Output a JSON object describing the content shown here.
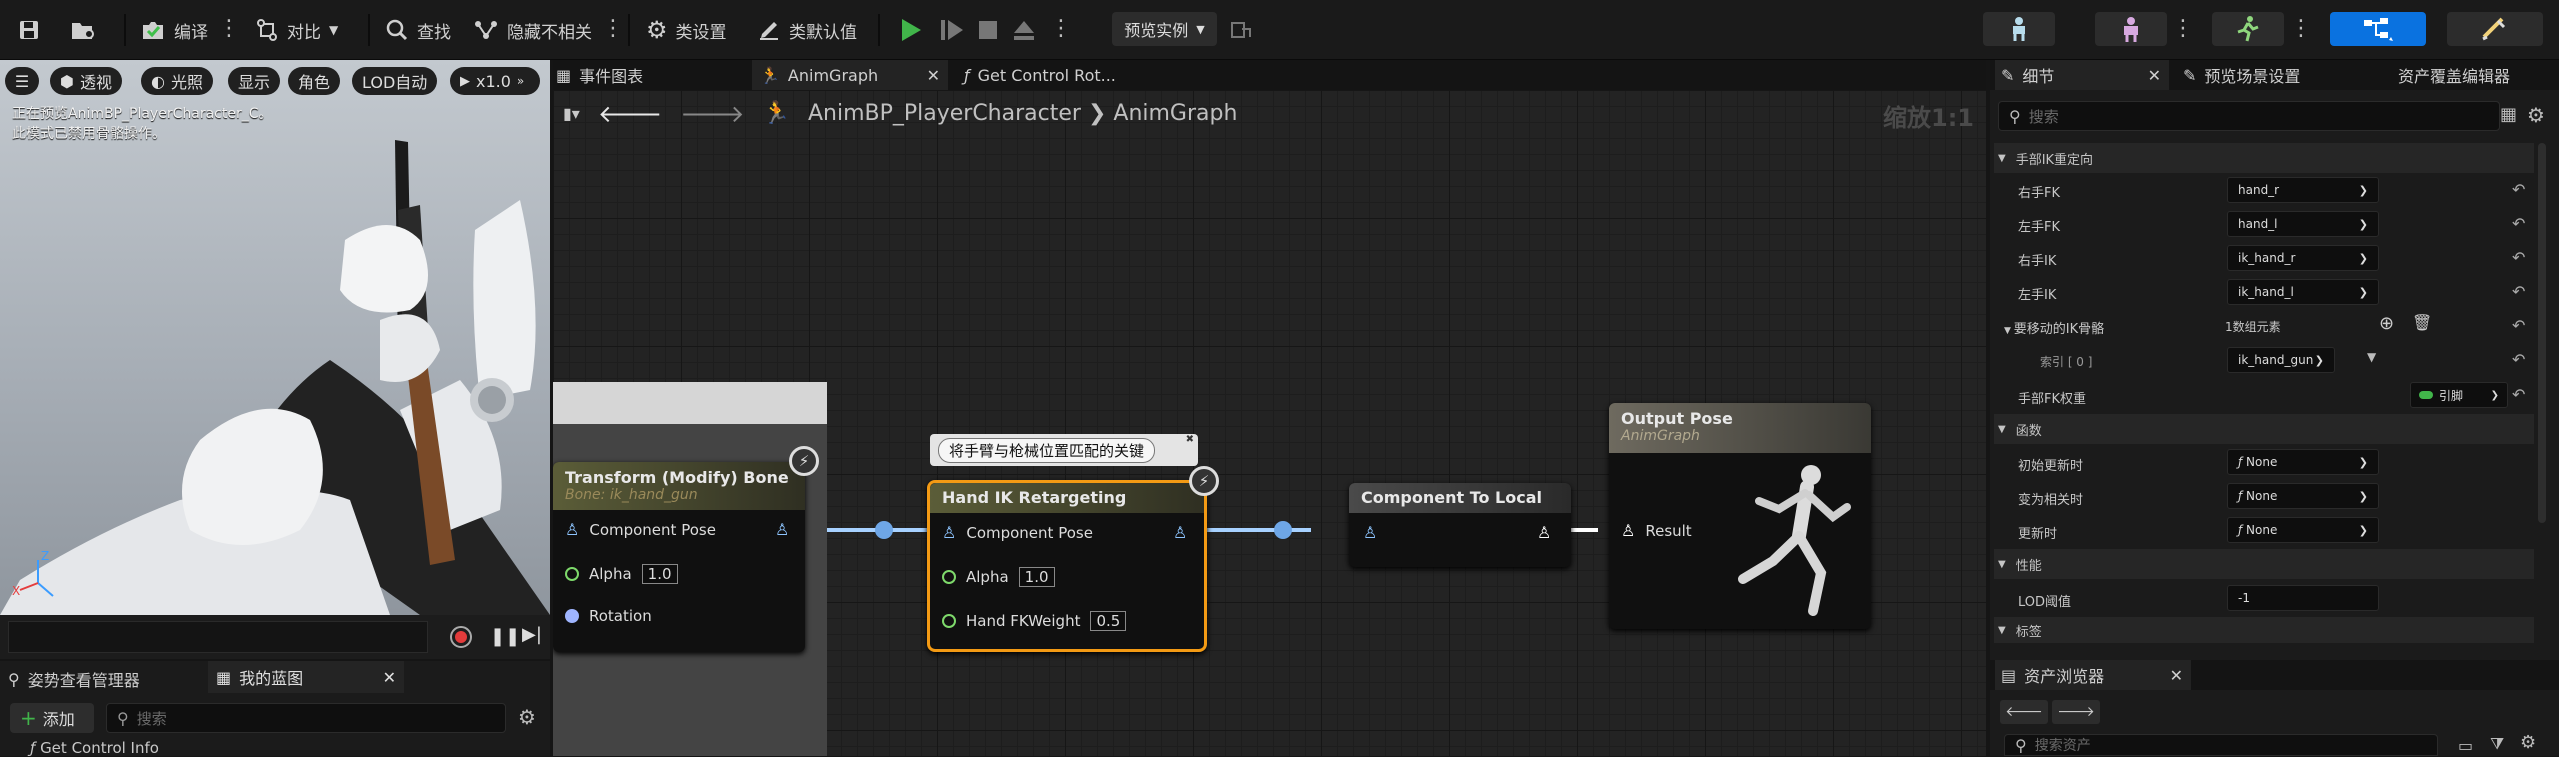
{
  "toolbar": {
    "compile": "编译",
    "diff": "对比",
    "find": "查找",
    "hide_unrelated": "隐藏不相关",
    "class_settings": "类设置",
    "class_defaults": "类默认值",
    "preview_instance": "预览实例"
  },
  "viewport": {
    "menu_icon": "hamburger-icon",
    "perspective": "透视",
    "lit": "光照",
    "show": "显示",
    "character": "角色",
    "lod": "LOD自动",
    "speed": "x1.0",
    "info_line1": "正在预览AnimBP_PlayerCharacter_C。",
    "info_line2": "此模式已禁用骨骼操作。"
  },
  "bottom_left": {
    "tab1": "姿势查看管理器",
    "tab2": "我的蓝图",
    "add_label": "添加",
    "search_placeholder": "搜索",
    "item": "Get Control Info"
  },
  "tabs": {
    "event_graph": "事件图表",
    "anim_graph": "AnimGraph",
    "get_control": "Get Control Rot..."
  },
  "graph": {
    "breadcrumb_bp": "AnimBP_PlayerCharacter",
    "breadcrumb_graph": "AnimGraph",
    "zoom": "缩放1:1",
    "comment": "将手臂与枪械位置匹配的关键",
    "nodes": {
      "transform": {
        "title": "Transform (Modify) Bone",
        "subtitle": "Bone: ik_hand_gun",
        "pose": "Component Pose",
        "alpha_label": "Alpha",
        "alpha": "1.0",
        "rotation": "Rotation"
      },
      "handik": {
        "title": "Hand IK Retargeting",
        "pose": "Component Pose",
        "alpha_label": "Alpha",
        "alpha": "1.0",
        "fk_label": "Hand FKWeight",
        "fk": "0.5"
      },
      "c2l": {
        "title": "Component To Local"
      },
      "output": {
        "title": "Output Pose",
        "subtitle": "AnimGraph",
        "result": "Result"
      }
    }
  },
  "details": {
    "tab_details": "细节",
    "tab_preview": "预览场景设置",
    "tab_asset_override": "资产覆盖编辑器",
    "search_placeholder": "搜索",
    "cat_hand_ik": "手部IK重定向",
    "right_fk": {
      "label": "右手FK",
      "value": "hand_r"
    },
    "left_fk": {
      "label": "左手FK",
      "value": "hand_l"
    },
    "right_ik": {
      "label": "右手IK",
      "value": "ik_hand_r"
    },
    "left_ik": {
      "label": "左手IK",
      "value": "ik_hand_l"
    },
    "ik_bones": {
      "label": "要移动的IK骨骼",
      "value": "1数组元素"
    },
    "index0": {
      "label": "索引 [ 0 ]",
      "value": "ik_hand_gun"
    },
    "hand_fk_weight": {
      "label": "手部FK权重",
      "value": "引脚"
    },
    "cat_functions": "函数",
    "initial_update": {
      "label": "初始更新时",
      "value": "None"
    },
    "become_relevant": {
      "label": "变为相关时",
      "value": "None"
    },
    "on_update": {
      "label": "更新时",
      "value": "None"
    },
    "cat_performance": "性能",
    "lod_threshold": {
      "label": "LOD阈值",
      "value": "-1"
    },
    "cat_tags": "标签"
  },
  "asset_browser": {
    "title": "资产浏览器",
    "search_placeholder": "搜索资产"
  },
  "colors": {
    "accent_blue": "#0a72e0",
    "exec_green": "#41b54a",
    "selected_orange": "#f39a14",
    "pose_wire": "#a7d1ff"
  }
}
